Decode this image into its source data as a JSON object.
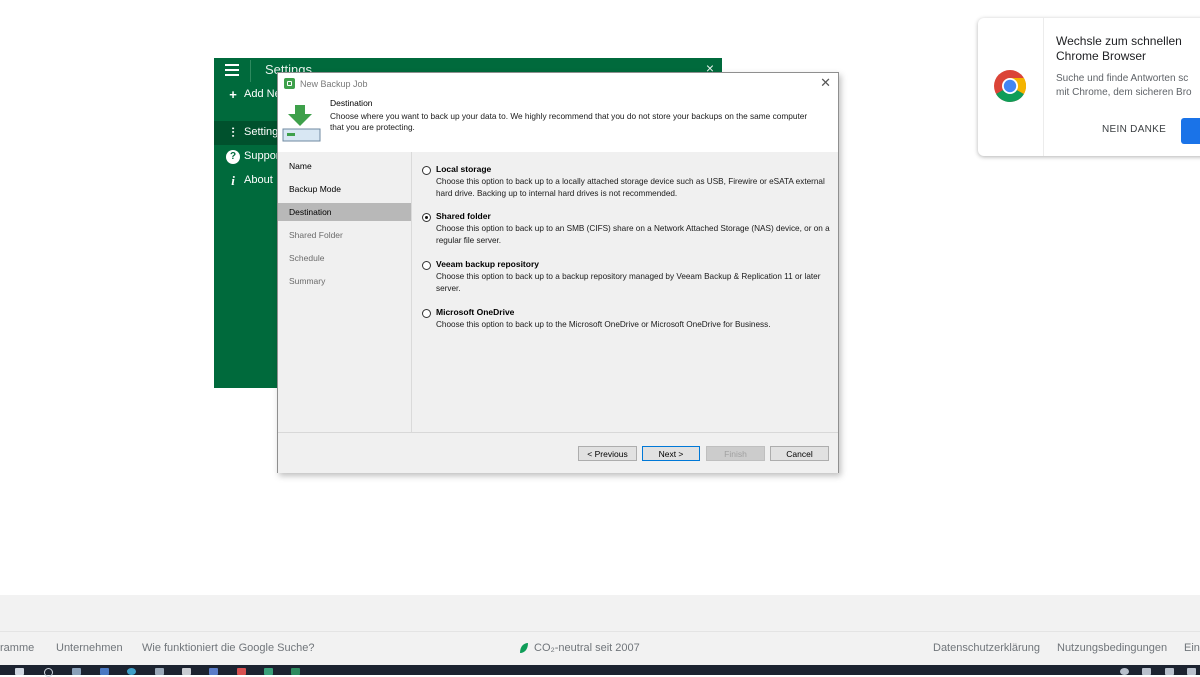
{
  "settings_window": {
    "title": "Settings",
    "close": "×",
    "items": [
      {
        "icon": "plus-icon",
        "glyph": "+",
        "label": "Add Ne"
      },
      {
        "icon": "sliders-icon",
        "glyph": "⫶",
        "label": "Setting"
      },
      {
        "icon": "help-icon",
        "glyph": "?",
        "label": "Suppor"
      },
      {
        "icon": "info-icon",
        "glyph": "i",
        "label": "About"
      }
    ]
  },
  "dialog": {
    "title": "New Backup Job",
    "close": "✕",
    "header_title": "Destination",
    "header_desc": "Choose where you want to back up your data to. We highly recommend that you do not store your backups on the same computer that you are protecting.",
    "nav": [
      "Name",
      "Backup Mode",
      "Destination",
      "Shared Folder",
      "Schedule",
      "Summary"
    ],
    "selected_nav": "Destination",
    "options": [
      {
        "title": "Local storage",
        "desc": "Choose this option to back up to a locally attached storage device such as USB, Firewire or eSATA external hard drive. Backing up to internal hard drives is not recommended.",
        "selected": false
      },
      {
        "title": "Shared folder",
        "desc": "Choose this option to back up to an SMB (CIFS) share on a Network Attached Storage (NAS) device, or on a regular file server.",
        "selected": true
      },
      {
        "title": "Veeam backup repository",
        "desc": "Choose this option to back up to a backup repository managed by Veeam Backup & Replication 11 or later server.",
        "selected": false
      },
      {
        "title": "Microsoft OneDrive",
        "desc": "Choose this option to back up to the Microsoft OneDrive or Microsoft OneDrive for Business.",
        "selected": false
      }
    ],
    "buttons": {
      "previous": "< Previous",
      "next": "Next >",
      "finish": "Finish",
      "cancel": "Cancel"
    }
  },
  "chrome_promo": {
    "title": "Wechsle zum schnellen Chrome Browser",
    "desc_line1": "Suche und finde Antworten sc",
    "desc_line2": "mit Chrome, dem sicheren Bro",
    "decline": "NEIN DANKE",
    "accent": "#1a73e8"
  },
  "google_footer": {
    "left_links": [
      "ramme",
      "Unternehmen",
      "Wie funktioniert die Google Suche?"
    ],
    "center": "CO₂-neutral seit 2007",
    "right_links": [
      "Datenschutzerklärung",
      "Nutzungsbedingungen",
      "Ein"
    ]
  },
  "colors": {
    "veeam_green": "#006a3c",
    "nav_selected": "#b8b8b8"
  }
}
